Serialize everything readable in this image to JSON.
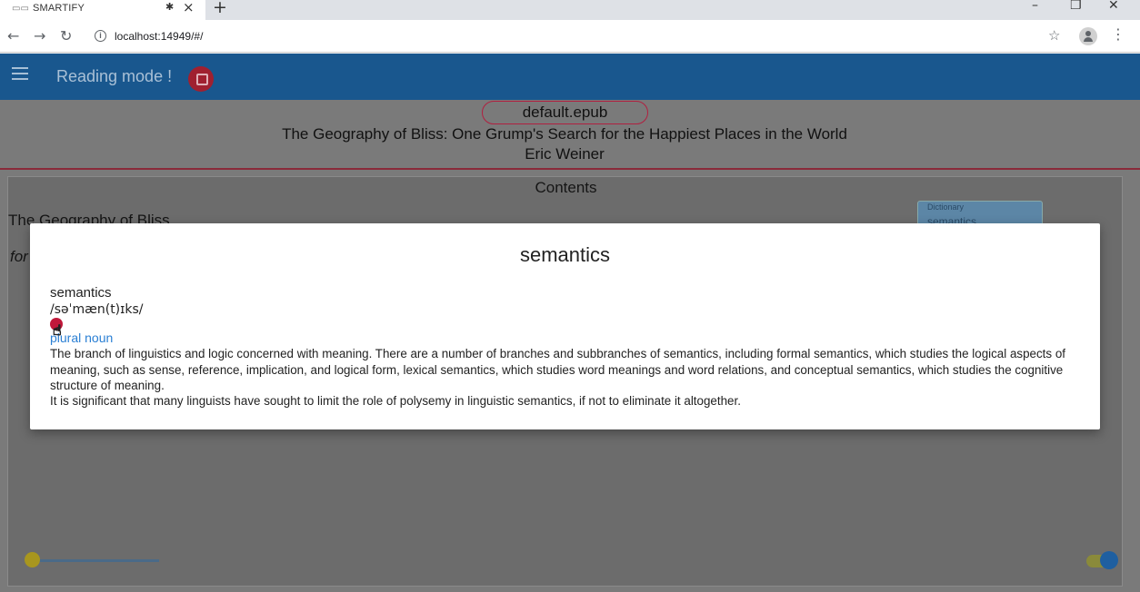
{
  "browser": {
    "tab": {
      "favicon": "book-icon",
      "title": "SMARTIFY",
      "pin_icon": "pin-icon",
      "close_icon": "close-icon"
    },
    "new_tab_icon": "plus-icon",
    "window_controls": {
      "minimize": "–",
      "restore": "❐",
      "close": "✕"
    },
    "url": "localhost:14949/#/"
  },
  "app": {
    "title": "Reading mode !",
    "book_file": "default.epub",
    "book_title": "The Geography of Bliss: One Grump's Search for the Happiest Places in the World",
    "book_author": "Eric Weiner",
    "contents_label": "Contents",
    "chapter_title": "The Geography of Bliss",
    "chapter_sub": "for",
    "dictionary": {
      "label": "Dictionary",
      "value": "semantics"
    },
    "font_slider": {
      "value": 0
    },
    "theme_toggle": {
      "on": true
    }
  },
  "dialog": {
    "title": "semantics",
    "headword": "semantics",
    "phonetic": "/səˈmæn(t)ɪks/",
    "part_of_speech": "plural noun",
    "definition": "The branch of linguistics and logic concerned with meaning. There are a number of branches and subbranches of semantics, including formal semantics, which studies the logical aspects of meaning, such as sense, reference, implication, and logical form, lexical semantics, which studies word meanings and word relations, and conceptual semantics, which studies the cognitive structure of meaning.",
    "example": "It is significant that many linguists have sought to limit the role of polysemy in linguistic semantics, if not to eliminate it altogether."
  },
  "colors": {
    "app_header": "#19578e",
    "accent": "#c0183a",
    "link": "#2a7fd4"
  }
}
